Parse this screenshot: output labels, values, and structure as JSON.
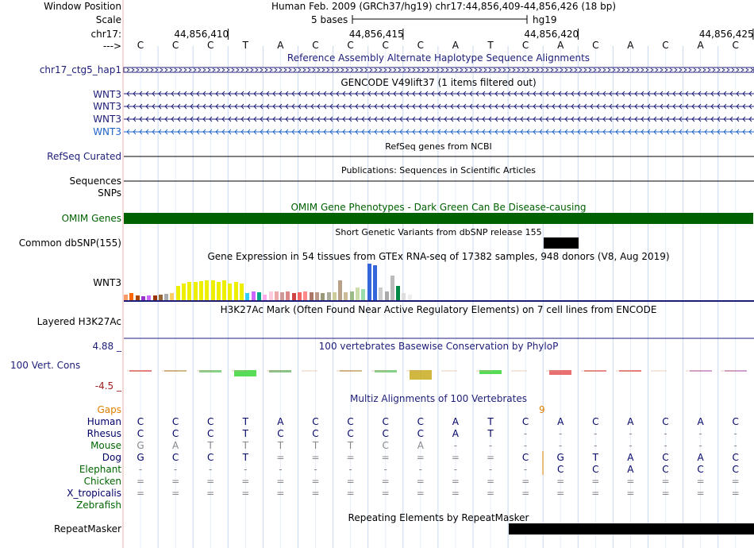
{
  "header": {
    "window_position_label": "Window Position",
    "window_position_value": "Human Feb. 2009 (GRCh37/hg19)   chr17:44,856,409-44,856,426 (18 bp)",
    "scale_label": "Scale",
    "scale_bar_text": "5 bases",
    "scale_assembly": "hg19",
    "chrom_label": "chr17:",
    "strand_label": "--->",
    "coordinate_ticks": [
      "44,856,410",
      "44,856,415",
      "44,856,420",
      "44,856,425"
    ],
    "reference_bases": [
      "C",
      "C",
      "C",
      "T",
      "A",
      "C",
      "C",
      "C",
      "C",
      "A",
      "T",
      "C",
      "A",
      "C",
      "A",
      "C",
      "A",
      "C"
    ]
  },
  "tracks": {
    "alt_haplotype": {
      "title": "Reference Assembly Alternate Haplotype Sequence Alignments",
      "item": "chr17_ctg5_hap1"
    },
    "gencode": {
      "title": "GENCODE V49lift37 (1 items filtered out)",
      "items": [
        "WNT3",
        "WNT3",
        "WNT3",
        "WNT3"
      ]
    },
    "refseq": {
      "label": "RefSeq Curated",
      "title": "RefSeq genes from NCBI"
    },
    "publications": {
      "title": "Publications: Sequences in Scientific Articles",
      "label": "Sequences"
    },
    "snps": {
      "label": "SNPs"
    },
    "omim": {
      "label": "OMIM Genes",
      "title": "OMIM Gene Phenotypes - Dark Green Can Be Disease-causing",
      "color": "#006100"
    },
    "dbsnp": {
      "label": "Common dbSNP(155)",
      "title": "Short Genetic Variants from dbSNP release 155"
    },
    "gtex": {
      "label": "WNT3",
      "title": "Gene Expression in 54 tissues from GTEx RNA-seq of 17382 samples, 948 donors (V8, Aug 2019)",
      "bars": [
        {
          "v": 0.15,
          "c": "#ff9966"
        },
        {
          "v": 0.2,
          "c": "#ff6600"
        },
        {
          "v": 0.12,
          "c": "#ab4500"
        },
        {
          "v": 0.1,
          "c": "#9933cc"
        },
        {
          "v": 0.13,
          "c": "#cc66ff"
        },
        {
          "v": 0.12,
          "c": "#993300"
        },
        {
          "v": 0.15,
          "c": "#996633"
        },
        {
          "v": 0.18,
          "c": "#aaaaaa"
        },
        {
          "v": 0.2,
          "c": "#ffcc66"
        },
        {
          "v": 0.4,
          "c": "#eeee00"
        },
        {
          "v": 0.45,
          "c": "#eeee00"
        },
        {
          "v": 0.5,
          "c": "#eeee00"
        },
        {
          "v": 0.5,
          "c": "#eeee00"
        },
        {
          "v": 0.53,
          "c": "#eeee00"
        },
        {
          "v": 0.55,
          "c": "#eeee00"
        },
        {
          "v": 0.55,
          "c": "#eeee00"
        },
        {
          "v": 0.5,
          "c": "#eeee00"
        },
        {
          "v": 0.55,
          "c": "#eeee00"
        },
        {
          "v": 0.45,
          "c": "#eeee00"
        },
        {
          "v": 0.5,
          "c": "#eeee00"
        },
        {
          "v": 0.45,
          "c": "#eeee00"
        },
        {
          "v": 0.2,
          "c": "#33ccff"
        },
        {
          "v": 0.25,
          "c": "#cc66ff"
        },
        {
          "v": 0.22,
          "c": "#00aa88"
        },
        {
          "v": 0.15,
          "c": "#ffaaee"
        },
        {
          "v": 0.25,
          "c": "#ffccdd"
        },
        {
          "v": 0.25,
          "c": "#eeaaaa"
        },
        {
          "v": 0.22,
          "c": "#cc9999"
        },
        {
          "v": 0.25,
          "c": "#dd8888"
        },
        {
          "v": 0.2,
          "c": "#cc4444"
        },
        {
          "v": 0.22,
          "c": "#ee6666"
        },
        {
          "v": 0.25,
          "c": "#ff8888"
        },
        {
          "v": 0.22,
          "c": "#aa7766"
        },
        {
          "v": 0.22,
          "c": "#bb9988"
        },
        {
          "v": 0.2,
          "c": "#999977"
        },
        {
          "v": 0.22,
          "c": "#aaaa99"
        },
        {
          "v": 0.22,
          "c": "#cccc99"
        },
        {
          "v": 0.55,
          "c": "#bba088"
        },
        {
          "v": 0.22,
          "c": "#ccbb99"
        },
        {
          "v": 0.25,
          "c": "#99bb88"
        },
        {
          "v": 0.35,
          "c": "#ccddaa"
        },
        {
          "v": 0.3,
          "c": "#99ddaa"
        },
        {
          "v": 1.0,
          "c": "#3366dd"
        },
        {
          "v": 0.95,
          "c": "#3366dd"
        },
        {
          "v": 0.35,
          "c": "#cccccc"
        },
        {
          "v": 0.25,
          "c": "#aaaaaa"
        },
        {
          "v": 0.68,
          "c": "#bbbbbb"
        },
        {
          "v": 0.4,
          "c": "#008844"
        },
        {
          "v": 0.2,
          "c": "#dddddd"
        },
        {
          "v": 0.15,
          "c": "#eeeeee"
        }
      ]
    },
    "h3k27ac": {
      "label": "Layered H3K27Ac",
      "title": "H3K27Ac Mark (Often Found Near Active Regulatory Elements) on 7 cell lines from ENCODE"
    },
    "conservation": {
      "label": "100 Vert. Cons",
      "title": "100 vertebrates Basewise Conservation by PhyloP",
      "ymax": "4.88 _",
      "ymin": "-4.5 _"
    },
    "multiz": {
      "title": "Multiz Alignments of 100 Vertebrates",
      "gaps_label": "Gaps",
      "gap_count": "9",
      "species": [
        {
          "name": "Human",
          "color": "#000066",
          "bases": [
            "C",
            "C",
            "C",
            "T",
            "A",
            "C",
            "C",
            "C",
            "C",
            "A",
            "T",
            "C",
            "A",
            "C",
            "A",
            "C",
            "A",
            "C"
          ]
        },
        {
          "name": "Rhesus",
          "color": "#000066",
          "bases": [
            "C",
            "C",
            "C",
            "T",
            "C",
            "C",
            "C",
            "C",
            "C",
            "A",
            "T",
            "-",
            "-",
            "-",
            "-",
            "-",
            "-",
            "-"
          ]
        },
        {
          "name": "Mouse",
          "color": "#006600",
          "bases": [
            "G",
            "A",
            "T",
            "T",
            "T",
            "T",
            "T",
            "C",
            "A",
            "-",
            "-",
            "-",
            "-",
            "-",
            "-",
            "-",
            "-",
            "-"
          ]
        },
        {
          "name": "Dog",
          "color": "#000066",
          "bases": [
            "G",
            "C",
            "C",
            "T",
            "=",
            "=",
            "=",
            "=",
            "=",
            "=",
            "=",
            "C",
            "G",
            "T",
            "A",
            "C",
            "A",
            "C"
          ]
        },
        {
          "name": "Elephant",
          "color": "#006600",
          "bases": [
            "-",
            "-",
            "-",
            "-",
            "-",
            "-",
            "-",
            "-",
            "-",
            "-",
            "-",
            "-",
            "C",
            "C",
            "A",
            "C",
            "C",
            "C"
          ]
        },
        {
          "name": "Chicken",
          "color": "#006600",
          "bases": [
            "=",
            "=",
            "=",
            "=",
            "=",
            "=",
            "=",
            "=",
            "=",
            "=",
            "=",
            "=",
            "=",
            "=",
            "=",
            "=",
            "=",
            "="
          ]
        },
        {
          "name": "X_tropicalis",
          "color": "#000066",
          "bases": [
            "=",
            "=",
            "=",
            "=",
            "=",
            "=",
            "=",
            "=",
            "=",
            "=",
            "=",
            "=",
            "=",
            "=",
            "=",
            "=",
            "=",
            "="
          ]
        },
        {
          "name": "Zebrafish",
          "color": "#006600",
          "bases": []
        }
      ]
    },
    "repeatmasker": {
      "label": "RepeatMasker",
      "title": "Repeating Elements by RepeatMasker"
    }
  },
  "colors": {
    "navy": "#1d1d78",
    "link_blue": "#1e3cc8",
    "omim_green": "#006100",
    "gaps_orange": "#e08000",
    "cons_red": "#a02020"
  }
}
